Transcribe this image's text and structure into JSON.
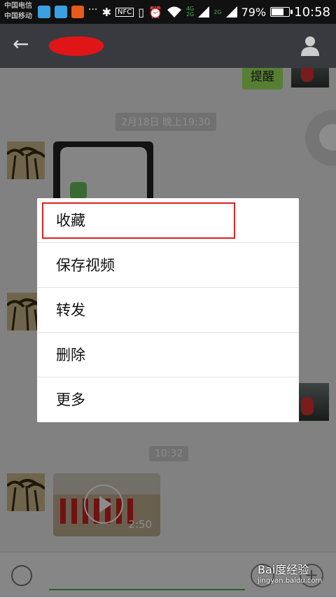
{
  "status_bar": {
    "carrier_1": "中国电信",
    "carrier_2": "中国移动",
    "network_4g": "4G",
    "network_2g": "2G",
    "battery": "79%",
    "battery_level": 0.79,
    "time": "10:58",
    "nfc": "NFC",
    "icons": [
      "bluetooth-icon",
      "nfc-icon",
      "vibrate-icon",
      "alarm-icon",
      "wifi-icon",
      "signal-icon"
    ]
  },
  "header": {
    "contact_name_redacted": true
  },
  "chat": {
    "messages": [
      {
        "type": "text",
        "side": "right",
        "text": "提醒"
      },
      {
        "type": "time",
        "text": "2月18日 晚上19:30"
      },
      {
        "type": "video",
        "side": "left"
      },
      {
        "type": "time",
        "text": "10:32"
      },
      {
        "type": "video",
        "side": "left",
        "duration": "2:50"
      }
    ]
  },
  "menu": {
    "items": [
      "收藏",
      "保存视频",
      "转发",
      "删除",
      "更多"
    ],
    "highlighted": "收藏"
  },
  "watermark": {
    "brand": "Bai度经验",
    "url": "jingyan.baidu.com"
  }
}
